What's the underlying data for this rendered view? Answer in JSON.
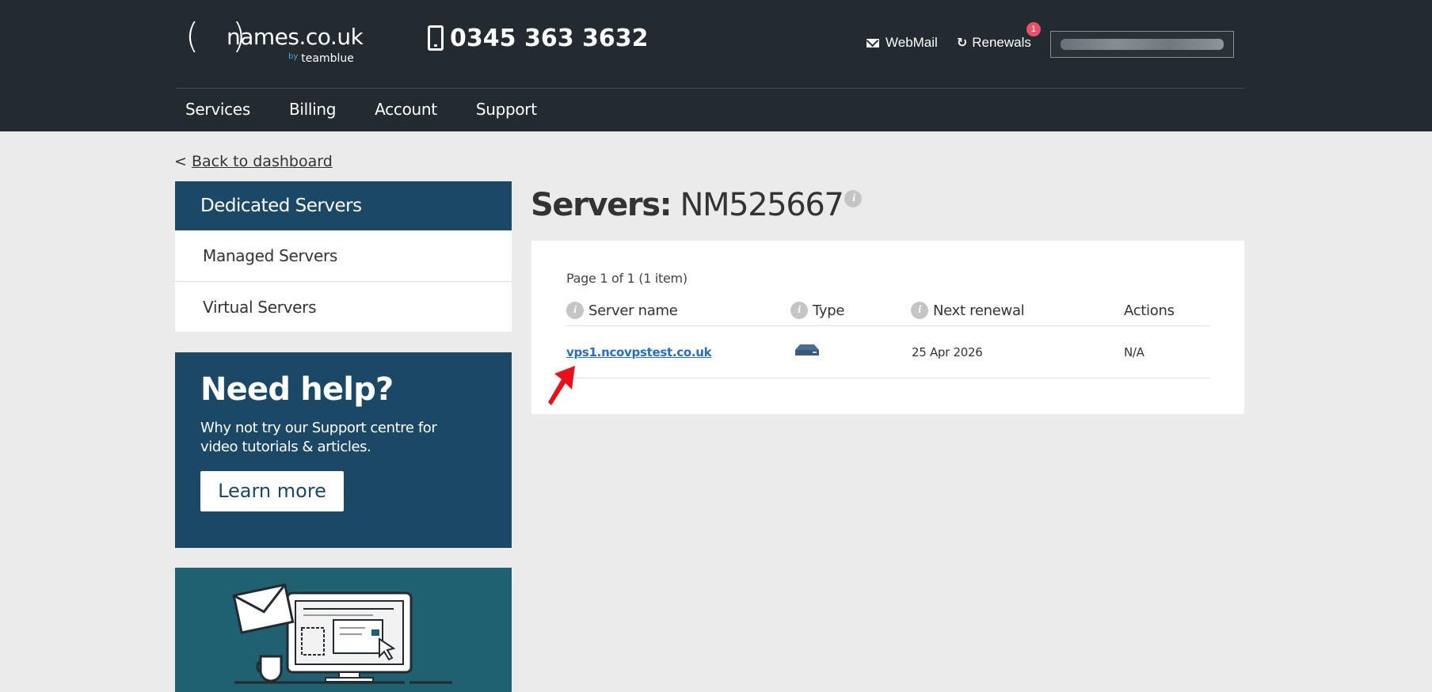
{
  "header": {
    "logo_text": "names.co.uk",
    "logo_parens": "( )",
    "logo_by": "by",
    "logo_sub": "teamblue",
    "phone": "0345 363 3632",
    "webmail": "WebMail",
    "renewals": "Renewals",
    "renewals_badge": "1"
  },
  "nav": [
    "Services",
    "Billing",
    "Account",
    "Support"
  ],
  "breadcrumb": {
    "prefix": "<",
    "back": "Back to dashboard"
  },
  "sidebar": {
    "heading": "Dedicated Servers",
    "items": [
      "Managed Servers",
      "Virtual Servers"
    ]
  },
  "help": {
    "title": "Need help?",
    "text": "Why not try our Support centre for video tutorials & articles.",
    "button": "Learn more"
  },
  "main": {
    "title_bold": "Servers:",
    "title_id": "NM525667",
    "page_info": "Page 1 of 1 (1 item)",
    "columns": [
      "Server name",
      "Type",
      "Next renewal",
      "Actions"
    ],
    "rows": [
      {
        "server_name": "vps1.ncovpstest.co.uk",
        "type_icon": "server-icon",
        "next_renewal": "25 Apr 2026",
        "actions": "N/A"
      }
    ]
  },
  "colors": {
    "header_bg": "#232a30",
    "brand_blue": "#1b4965",
    "link": "#2a6ebb",
    "badge": "#e9516b",
    "promo_bg": "#1f6071"
  }
}
